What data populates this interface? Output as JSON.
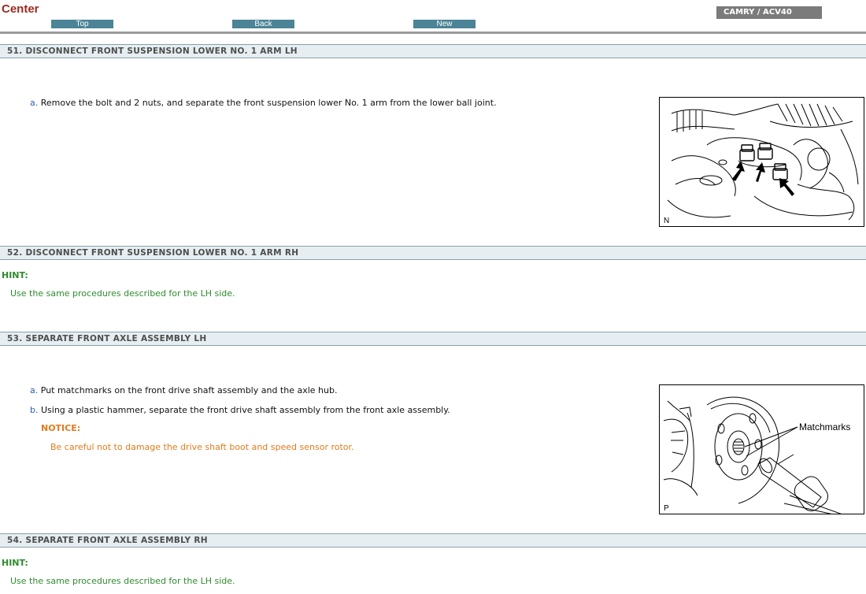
{
  "header": {
    "title": "Center",
    "nav": {
      "top_label": "Top",
      "back_label": "Back",
      "new_label": "New"
    },
    "model": "CAMRY / ACV40"
  },
  "steps": [
    {
      "heading": "51. DISCONNECT FRONT SUSPENSION LOWER NO. 1 ARM LH",
      "substeps": [
        {
          "label": "a.",
          "text": "Remove the bolt and 2 nuts, and separate the front suspension lower No. 1 arm from the lower ball joint."
        }
      ],
      "figure_code": "N"
    },
    {
      "heading": "52. DISCONNECT FRONT SUSPENSION LOWER NO. 1 ARM RH",
      "hint_label": "HINT:",
      "hint_text": "Use the same procedures described for the LH side."
    },
    {
      "heading": "53. SEPARATE FRONT AXLE ASSEMBLY LH",
      "substeps": [
        {
          "label": "a.",
          "text": "Put matchmarks on the front drive shaft assembly and the axle hub."
        },
        {
          "label": "b.",
          "text": "Using a plastic hammer, separate the front drive shaft assembly from the front axle assembly."
        }
      ],
      "notice_label": "NOTICE:",
      "notice_text": "Be careful not to damage the drive shaft boot and speed sensor rotor.",
      "figure_label": "Matchmarks",
      "figure_code": "P"
    },
    {
      "heading": "54. SEPARATE FRONT AXLE ASSEMBLY RH",
      "hint_label": "HINT:",
      "hint_text": "Use the same procedures described for the LH side."
    }
  ]
}
